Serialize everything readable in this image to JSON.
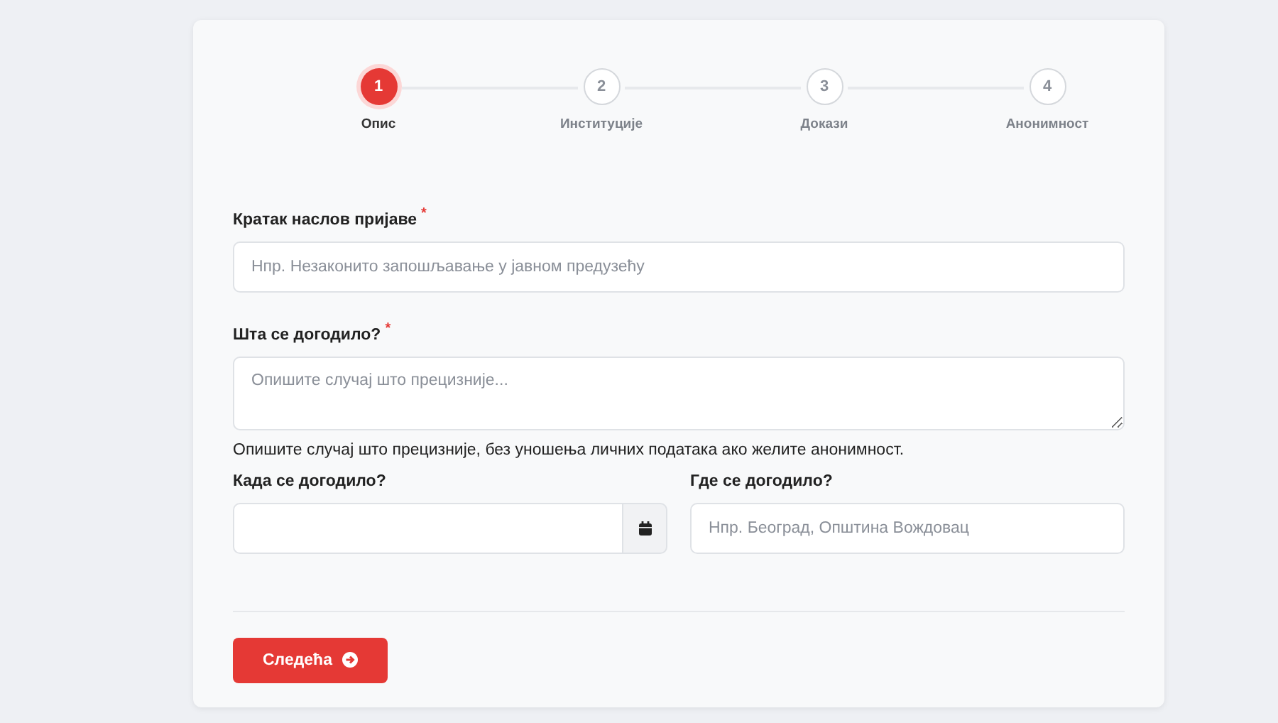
{
  "steps": [
    {
      "number": "1",
      "label": "Опис",
      "selected": true
    },
    {
      "number": "2",
      "label": "Институције",
      "selected": false
    },
    {
      "number": "3",
      "label": "Докази",
      "selected": false
    },
    {
      "number": "4",
      "label": "Анонимност",
      "selected": false
    }
  ],
  "fields": [
    {
      "kind": "text",
      "label": "Кратак наслов пријаве",
      "required_mark": "*",
      "placeholder": "Нпр. Незаконито запошљавање у јавном предузећу"
    },
    {
      "kind": "textarea",
      "label": "Шта се догодило?",
      "required_mark": "*",
      "placeholder": "Опишите случај што прецизније...",
      "help": "Опишите случај што прецизније, без уношења личних података ако желите анонимност."
    }
  ],
  "row": [
    {
      "kind": "date",
      "label": "Када се догодило?"
    },
    {
      "kind": "text",
      "label": "Где се догодило?",
      "placeholder": "Нпр. Београд, Општина Вождовац"
    }
  ],
  "next_button": {
    "label": "Следећа"
  }
}
